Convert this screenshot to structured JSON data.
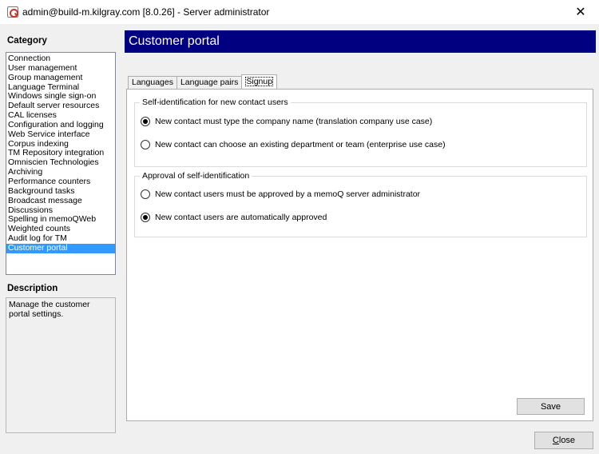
{
  "window": {
    "title": "admin@build-m.kilgray.com [8.0.26] - Server administrator",
    "close_glyph": "✕"
  },
  "left": {
    "category_heading": "Category",
    "categories": [
      "Connection",
      "User management",
      "Group management",
      "Language Terminal",
      "Windows single sign-on",
      "Default server resources",
      "CAL licenses",
      "Configuration and logging",
      "Web Service interface",
      "Corpus indexing",
      "TM Repository integration",
      "Omniscien Technologies",
      "Archiving",
      "Performance counters",
      "Background tasks",
      "Broadcast message",
      "Discussions",
      "Spelling in memoQWeb",
      "Weighted counts",
      "Audit log for TM",
      "Customer portal"
    ],
    "selected_index": 20,
    "description_heading": "Description",
    "description_text": "Manage the customer portal settings."
  },
  "main": {
    "header": "Customer portal",
    "tabs": [
      "Languages",
      "Language pairs",
      "Signup"
    ],
    "active_tab": 2,
    "group1": {
      "legend": "Self-identification for new contact users",
      "option1": "New contact must type the company name (translation company use case)",
      "option2": "New contact can choose an existing department or team (enterprise use case)",
      "selected": 1
    },
    "group2": {
      "legend": "Approval of self-identification",
      "option1": "New contact users must be approved by a memoQ server administrator",
      "option2": "New contact users are automatically approved",
      "selected": 2
    },
    "save_label": "Save"
  },
  "footer": {
    "close_label_underlined": "C",
    "close_label_rest": "lose"
  }
}
